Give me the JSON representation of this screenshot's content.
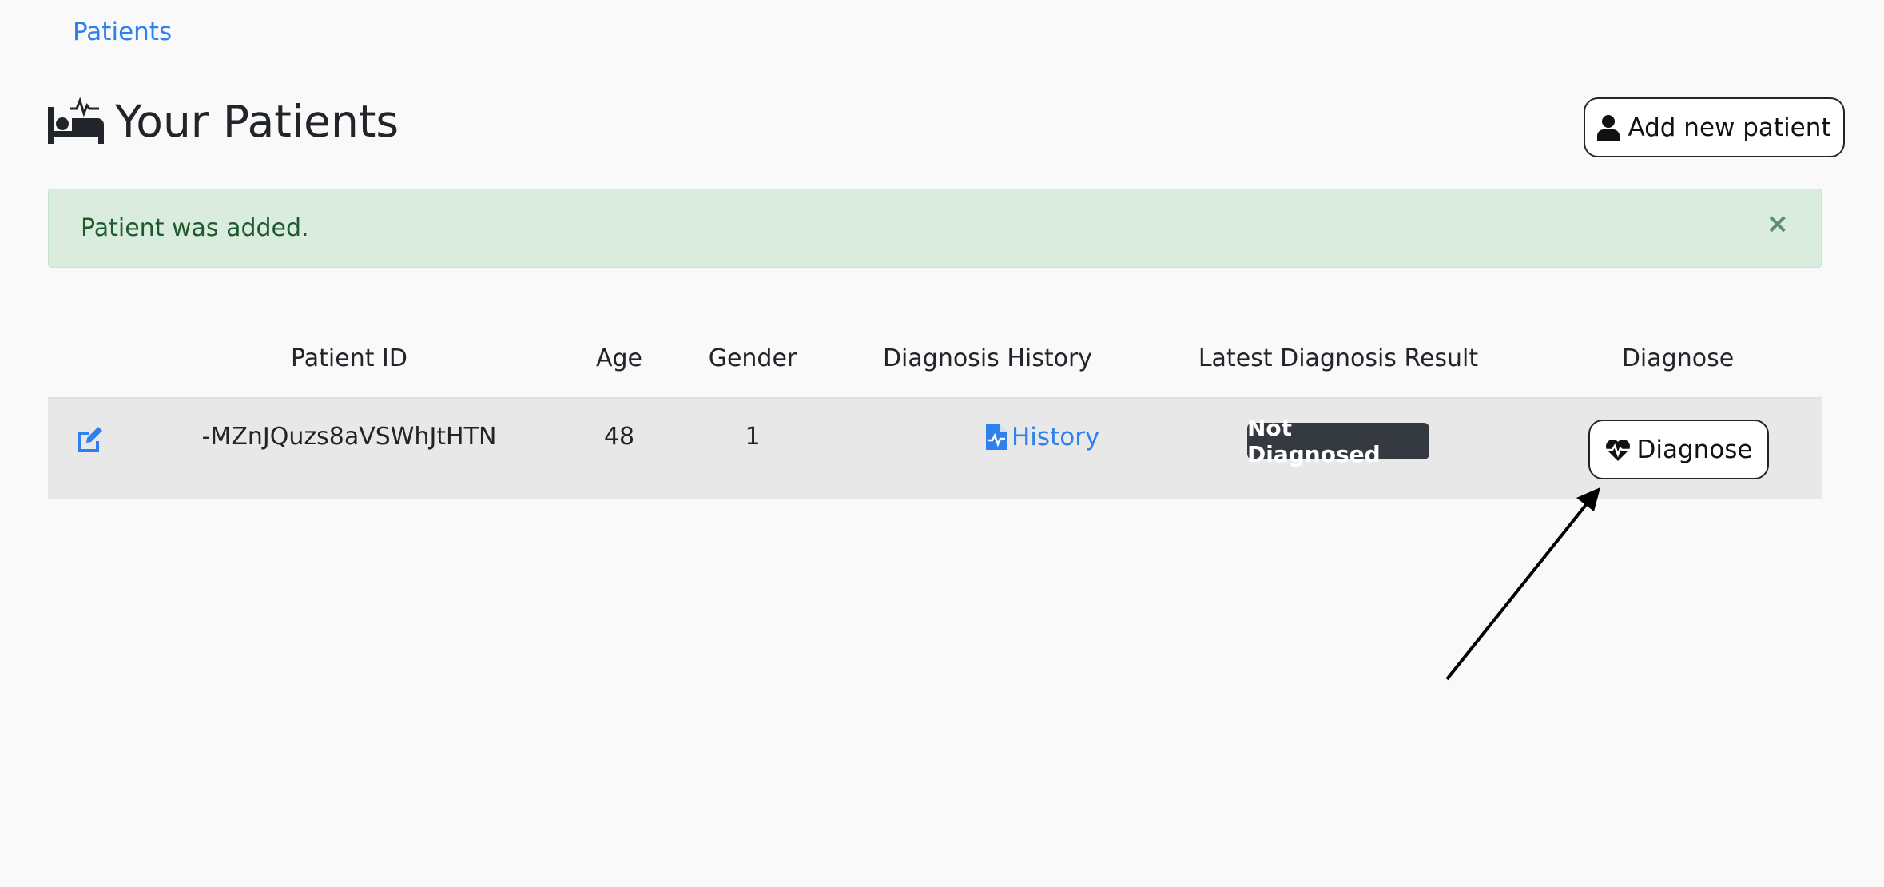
{
  "breadcrumb": {
    "patients_link": "Patients"
  },
  "header": {
    "title": "Your Patients",
    "icon": "bed-pulse-icon"
  },
  "actions": {
    "add_patient_label": "Add new patient",
    "add_patient_icon": "user-icon"
  },
  "alert": {
    "message": "Patient was added.",
    "close": "×",
    "color": "#d9ecdd"
  },
  "table": {
    "headers": [
      "Patient ID",
      "Age",
      "Gender",
      "Diagnosis History",
      "Latest Diagnosis Result",
      "Diagnose"
    ],
    "rows": [
      {
        "patient_id": "-MZnJQuzs8aVSWhJtHTN",
        "age": "48",
        "gender": "1",
        "history_label": "History",
        "latest_result": "Not Diagnosed",
        "diagnose_label": "Diagnose"
      }
    ]
  },
  "colors": {
    "link": "#2f80ed",
    "badge": "#343a40",
    "row_bg": "#e8e8e8"
  }
}
